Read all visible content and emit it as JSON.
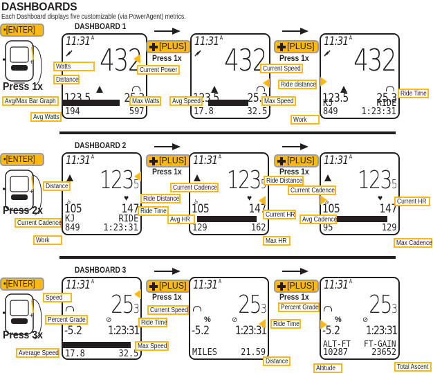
{
  "page": {
    "title": "DASHBOARDS",
    "subtitle": "Each Dashboard displays five customizable (via PowerAgent) metrics."
  },
  "buttons": {
    "enter_label": "[ENTER]",
    "plus_label": "[PLUS]",
    "press_1x": "Press 1x"
  },
  "colors": {
    "accent": "#fdb913",
    "ink": "#231f20",
    "button_border": "#9d9d9d"
  },
  "dashboards": [
    {
      "title": "DASHBOARD 1",
      "press_label": "Press 1x",
      "screens": [
        {
          "clock": "11:31",
          "ampm": "A",
          "big": "432",
          "left_mid": "123.5",
          "right_mid": "25.3",
          "bottom_left": "194",
          "bottom_right": "597",
          "has_bar": true,
          "callouts": [
            "Watts",
            "Distance",
            "Avg/Max Bar Graph",
            "Avg Watts",
            "Current Power",
            "Max Watts"
          ]
        },
        {
          "clock": "11:31",
          "ampm": "A",
          "big": "432",
          "left_mid": "123.5",
          "right_mid": "25.3",
          "bottom_left": "17.8",
          "bottom_right": "32.5",
          "has_bar": true,
          "callouts": [
            "Avg Speed",
            "Current Speed",
            "Max Speed"
          ]
        },
        {
          "clock": "11:31",
          "ampm": "A",
          "big": "432",
          "left_mid": "123.5",
          "right_mid": "25.3",
          "label_left": "KJ",
          "label_right": "RIDE",
          "bottom_left": "849",
          "bottom_right": "1:23:31",
          "has_bar": false,
          "callouts": [
            "Ride distance",
            "Ride Time",
            "Work"
          ]
        }
      ]
    },
    {
      "title": "DASHBOARD 2",
      "press_label": "Press 2x",
      "screens": [
        {
          "clock": "11:31",
          "ampm": "A",
          "big": "123",
          "big_sub": "5",
          "left_mid": "105",
          "right_mid": "147",
          "label_left": "KJ",
          "label_right": "RIDE",
          "bottom_left": "849",
          "bottom_right": "1:23:31",
          "has_bar": false,
          "callouts": [
            "Distance",
            "Current Cadence",
            "Work",
            "Ride Distance",
            "Ride Time"
          ]
        },
        {
          "clock": "11:31",
          "ampm": "A",
          "big": "123",
          "big_sub": "5",
          "left_mid": "105",
          "right_mid": "147",
          "bottom_left": "129",
          "bottom_right": "162",
          "has_bar": true,
          "callouts": [
            "Current Cadence",
            "Avg HR",
            "Ride Distance",
            "Current HR",
            "Max HR"
          ]
        },
        {
          "clock": "11:31",
          "ampm": "A",
          "big": "123",
          "big_sub": "5",
          "left_mid": "105",
          "right_mid": "147",
          "bottom_left": "95",
          "bottom_right": "129",
          "has_bar": true,
          "callouts": [
            "Current Cadence",
            "Avg Cadence",
            "Current HR",
            "Max Cadence"
          ]
        }
      ]
    },
    {
      "title": "DASHBOARD 3",
      "press_label": "Press 3x",
      "screens": [
        {
          "clock": "11:31",
          "ampm": "A",
          "big": "25",
          "big_sub": "3",
          "pct": "%",
          "left_mid": "-5.2",
          "right_mid": "1:23:31",
          "bottom_left": "17.8",
          "bottom_right": "32.5",
          "has_bar": true,
          "callouts": [
            "Speed",
            "Percent Grade",
            "Average Speed",
            "Current Speed",
            "Ride Time",
            "Max Speed"
          ]
        },
        {
          "clock": "11:31",
          "ampm": "A",
          "big": "25",
          "big_sub": "3",
          "pct": "%",
          "left_mid": "-5.2",
          "right_mid": "1:23:31",
          "bottom_left": "MILES",
          "bottom_right": "21.59",
          "has_bar": false,
          "callouts": [
            "Ride Time",
            "Distance"
          ]
        },
        {
          "clock": "11:31",
          "ampm": "A",
          "big": "25",
          "big_sub": "3",
          "pct": "%",
          "left_mid": "-5.2",
          "right_mid": "1:23:31",
          "label_left": "ALT-FT",
          "label_right": "FT-GAIN",
          "bottom_left": "10287",
          "bottom_right": "23652",
          "has_bar": false,
          "callouts": [
            "Percent Grade",
            "Altitude",
            "Total Ascent"
          ]
        }
      ]
    }
  ]
}
